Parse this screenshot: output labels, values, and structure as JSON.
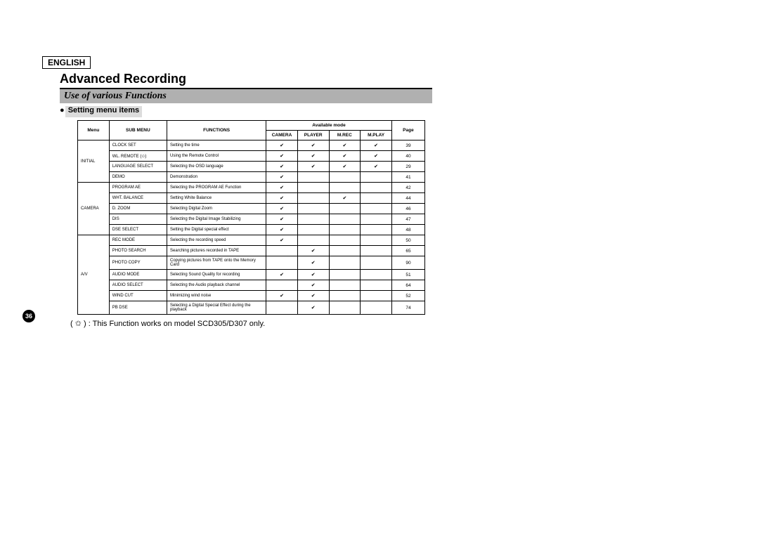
{
  "lang": "ENGLISH",
  "title": "Advanced Recording",
  "subtitle": "Use of various Functions",
  "section": "Setting menu items",
  "headers": {
    "menu": "Menu",
    "sub": "SUB MENU",
    "func": "FUNCTIONS",
    "avail": "Available mode",
    "camera": "CAMERA",
    "player": "PLAYER",
    "mrec": "M.REC",
    "mplay": "M.PLAY",
    "page": "Page"
  },
  "check": "✔",
  "groups": [
    {
      "menu": "INITIAL",
      "rows": [
        {
          "sub": "CLOCK SET",
          "func": "Setting the time",
          "m": [
            1,
            1,
            1,
            1
          ],
          "page": "39"
        },
        {
          "sub": "WL. REMOTE (✩)",
          "func": "Using the Remote Control",
          "m": [
            1,
            1,
            1,
            1
          ],
          "page": "40"
        },
        {
          "sub": "LANGUAGE SELECT",
          "func": "Selecting the OSD language",
          "m": [
            1,
            1,
            1,
            1
          ],
          "page": "29"
        },
        {
          "sub": "DEMO",
          "func": "Demonstration",
          "m": [
            1,
            0,
            0,
            0
          ],
          "page": "41"
        }
      ]
    },
    {
      "menu": "CAMERA",
      "rows": [
        {
          "sub": "PROGRAM AE",
          "func": "Selecting the PROGRAM AE Function",
          "m": [
            1,
            0,
            0,
            0
          ],
          "page": "42"
        },
        {
          "sub": "WHT. BALANCE",
          "func": "Setting White Balance",
          "m": [
            1,
            0,
            1,
            0
          ],
          "page": "44"
        },
        {
          "sub": "D. ZOOM",
          "func": "Selecting Digital Zoom",
          "m": [
            1,
            0,
            0,
            0
          ],
          "page": "46"
        },
        {
          "sub": "DIS",
          "func": "Selecting the Digital Image Stabilizing",
          "m": [
            1,
            0,
            0,
            0
          ],
          "page": "47"
        },
        {
          "sub": "DSE SELECT",
          "func": "Setting the Digital special effect",
          "m": [
            1,
            0,
            0,
            0
          ],
          "page": "48"
        }
      ]
    },
    {
      "menu": "A/V",
      "rows": [
        {
          "sub": "REC MODE",
          "func": "Selecting the recording speed",
          "m": [
            1,
            0,
            0,
            0
          ],
          "page": "50"
        },
        {
          "sub": "PHOTO SEARCH",
          "func": "Searching pictures recorded in TAPE",
          "m": [
            0,
            1,
            0,
            0
          ],
          "page": "65"
        },
        {
          "sub": "PHOTO COPY",
          "func": "Copying pictures from TAPE onto the Memory Card",
          "m": [
            0,
            1,
            0,
            0
          ],
          "page": "90"
        },
        {
          "sub": "AUDIO MODE",
          "func": "Selecting Sound Quality for recording",
          "m": [
            1,
            1,
            0,
            0
          ],
          "page": "51"
        },
        {
          "sub": "AUDIO SELECT",
          "func": "Selecting the Audio playback channel",
          "m": [
            0,
            1,
            0,
            0
          ],
          "page": "64"
        },
        {
          "sub": "WIND CUT",
          "func": "Minimizing wind noise",
          "m": [
            1,
            1,
            0,
            0
          ],
          "page": "52"
        },
        {
          "sub": "PB DSE",
          "func": "Selecting a Digital Special Effect during the playback",
          "m": [
            0,
            1,
            0,
            0
          ],
          "page": "74"
        }
      ]
    }
  ],
  "footnote": "( ✩ )  : This Function works on model SCD305/D307 only.",
  "pagenum": "36"
}
